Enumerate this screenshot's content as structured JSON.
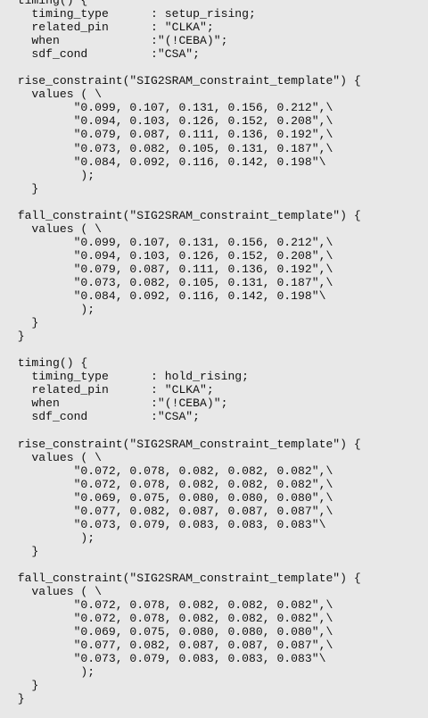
{
  "document": {
    "lines": [
      "  timing() {",
      "    timing_type      : setup_rising;",
      "    related_pin      : \"CLKA\";",
      "    when             :\"(!CEBA)\";",
      "    sdf_cond         :\"CSA\";",
      "",
      "  rise_constraint(\"SIG2SRAM_constraint_template\") {",
      "    values ( \\",
      "          \"0.099, 0.107, 0.131, 0.156, 0.212\",\\",
      "          \"0.094, 0.103, 0.126, 0.152, 0.208\",\\",
      "          \"0.079, 0.087, 0.111, 0.136, 0.192\",\\",
      "          \"0.073, 0.082, 0.105, 0.131, 0.187\",\\",
      "          \"0.084, 0.092, 0.116, 0.142, 0.198\"\\",
      "           );",
      "    }",
      "",
      "  fall_constraint(\"SIG2SRAM_constraint_template\") {",
      "    values ( \\",
      "          \"0.099, 0.107, 0.131, 0.156, 0.212\",\\",
      "          \"0.094, 0.103, 0.126, 0.152, 0.208\",\\",
      "          \"0.079, 0.087, 0.111, 0.136, 0.192\",\\",
      "          \"0.073, 0.082, 0.105, 0.131, 0.187\",\\",
      "          \"0.084, 0.092, 0.116, 0.142, 0.198\"\\",
      "           );",
      "    }",
      "  }",
      "",
      "  timing() {",
      "    timing_type      : hold_rising;",
      "    related_pin      : \"CLKA\";",
      "    when             :\"(!CEBA)\";",
      "    sdf_cond         :\"CSA\";",
      "",
      "  rise_constraint(\"SIG2SRAM_constraint_template\") {",
      "    values ( \\",
      "          \"0.072, 0.078, 0.082, 0.082, 0.082\",\\",
      "          \"0.072, 0.078, 0.082, 0.082, 0.082\",\\",
      "          \"0.069, 0.075, 0.080, 0.080, 0.080\",\\",
      "          \"0.077, 0.082, 0.087, 0.087, 0.087\",\\",
      "          \"0.073, 0.079, 0.083, 0.083, 0.083\"\\",
      "           );",
      "    }",
      "",
      "  fall_constraint(\"SIG2SRAM_constraint_template\") {",
      "    values ( \\",
      "          \"0.072, 0.078, 0.082, 0.082, 0.082\",\\",
      "          \"0.072, 0.078, 0.082, 0.082, 0.082\",\\",
      "          \"0.069, 0.075, 0.080, 0.080, 0.080\",\\",
      "          \"0.077, 0.082, 0.087, 0.087, 0.087\",\\",
      "          \"0.073, 0.079, 0.083, 0.083, 0.083\"\\",
      "           );",
      "    }",
      "  }"
    ]
  }
}
